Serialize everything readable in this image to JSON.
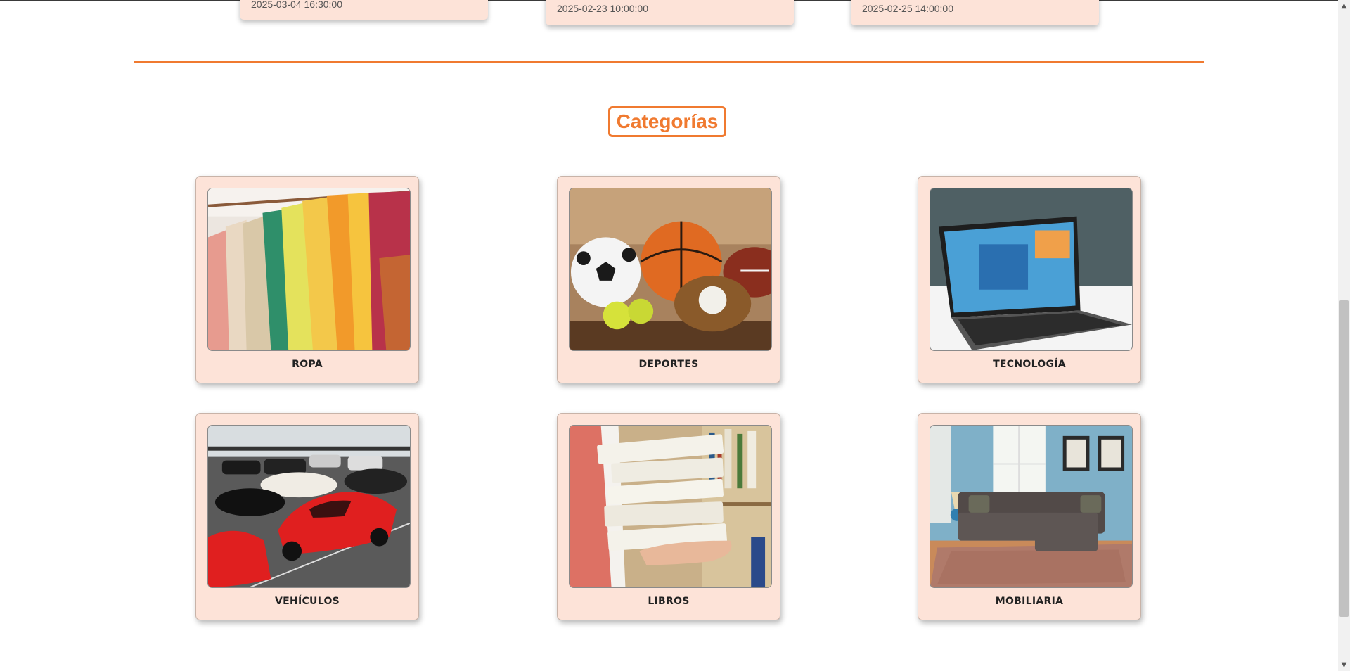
{
  "events": [
    {
      "datetime": "2025-03-04 16:30:00"
    },
    {
      "datetime": "2025-02-23 10:00:00"
    },
    {
      "datetime": "2025-02-25 14:00:00"
    }
  ],
  "categories_section": {
    "title": "Categorías",
    "accent_color": "#f07a30",
    "card_color": "#fde3d8",
    "items": [
      {
        "label": "ROPA",
        "image": "clothing-rack-photo"
      },
      {
        "label": "DEPORTES",
        "image": "sports-balls-photo"
      },
      {
        "label": "TECNOLOGÍA",
        "image": "laptop-tablet-photo"
      },
      {
        "label": "VEHÍCULOS",
        "image": "sports-cars-photo"
      },
      {
        "label": "LIBROS",
        "image": "stack-of-books-photo"
      },
      {
        "label": "MOBILIARIA",
        "image": "living-room-sofa-photo"
      }
    ]
  }
}
